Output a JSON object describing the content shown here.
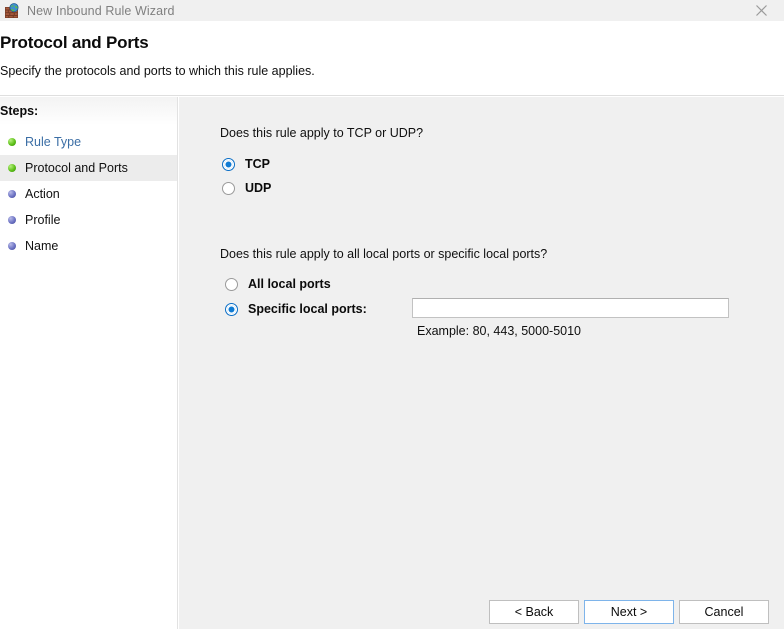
{
  "window": {
    "title": "New Inbound Rule Wizard",
    "icon": "firewall-globe-icon",
    "close_label": "✕"
  },
  "header": {
    "title": "Protocol and Ports",
    "subtitle": "Specify the protocols and ports to which this rule applies."
  },
  "sidebar": {
    "heading": "Steps:",
    "items": [
      {
        "label": "Rule Type",
        "state": "completed",
        "bullet": "green-bullet-icon"
      },
      {
        "label": "Protocol and Ports",
        "state": "current",
        "bullet": "green-bullet-icon"
      },
      {
        "label": "Action",
        "state": "upcoming",
        "bullet": "blue-bullet-icon"
      },
      {
        "label": "Profile",
        "state": "upcoming",
        "bullet": "blue-bullet-icon"
      },
      {
        "label": "Name",
        "state": "upcoming",
        "bullet": "blue-bullet-icon"
      }
    ]
  },
  "main": {
    "protocol_question": "Does this rule apply to TCP or UDP?",
    "protocol_options": [
      {
        "label": "TCP",
        "selected": true
      },
      {
        "label": "UDP",
        "selected": false
      }
    ],
    "ports_question": "Does this rule apply to all local ports or specific local ports?",
    "ports_options": [
      {
        "label": "All local ports",
        "selected": false
      },
      {
        "label": "Specific local ports:",
        "selected": true
      }
    ],
    "ports_input_value": "",
    "ports_input_placeholder": "",
    "ports_example": "Example: 80, 443, 5000-5010"
  },
  "footer": {
    "back_label": "< Back",
    "next_label": "Next >",
    "cancel_label": "Cancel"
  },
  "colors": {
    "accent": "#0f7bd4",
    "link": "#3b6ea5",
    "panel": "#f0f0f0",
    "focus_border": "#7eb4ea"
  }
}
